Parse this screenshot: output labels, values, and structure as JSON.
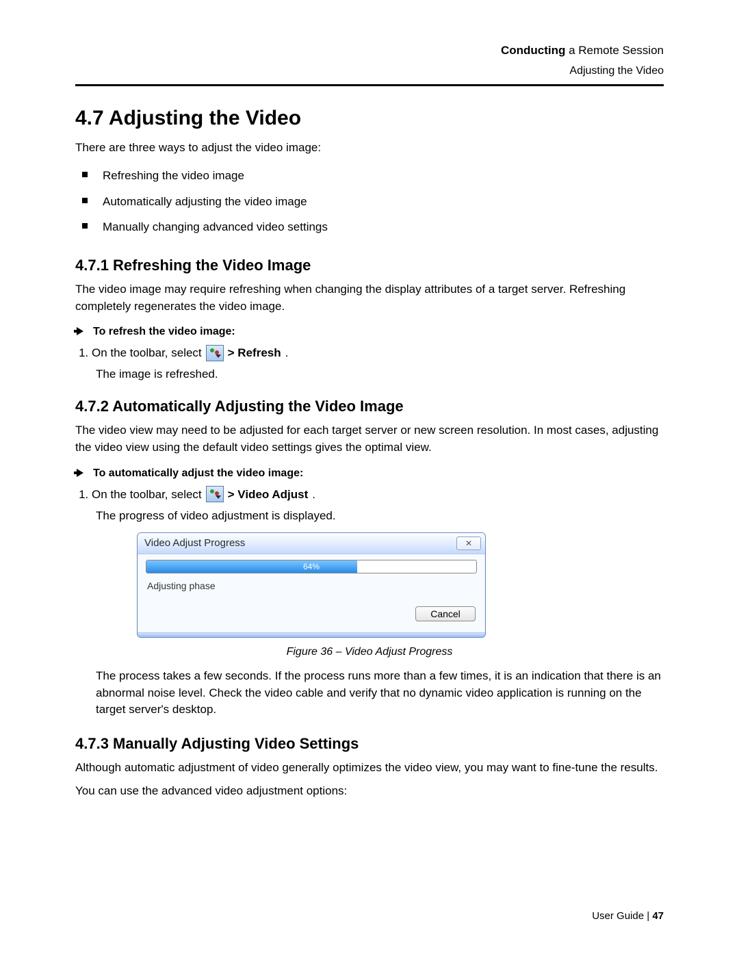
{
  "header": {
    "crumb_bold": "Conducting",
    "crumb_rest": " a Remote Session",
    "sub": "Adjusting the Video"
  },
  "s47": {
    "title": "4.7   Adjusting the Video",
    "intro": "There are three ways to adjust the video image:",
    "bullets": [
      "Refreshing the video image",
      "Automatically adjusting the video image",
      "Manually changing advanced video settings"
    ]
  },
  "s471": {
    "title": "4.7.1   Refreshing the Video Image",
    "para": "The video image may require refreshing when changing the display attributes of a target server. Refreshing completely regenerates the video image.",
    "instr_title": "To refresh the video image:",
    "step1_pre": "On the toolbar, select ",
    "step1_post": " > Refresh",
    "step1_dot": ".",
    "result": "The image is refreshed."
  },
  "s472": {
    "title": "4.7.2   Automatically Adjusting the Video Image",
    "para": "The video view may need to be adjusted for each target server or new screen resolution. In most cases, adjusting the video view using the default video settings gives the optimal view.",
    "instr_title": "To automatically adjust the video image:",
    "step1_pre": "On the toolbar, select ",
    "step1_post": " > Video Adjust",
    "step1_dot": ".",
    "result": "The progress of video adjustment is displayed.",
    "dialog": {
      "title": "Video Adjust Progress",
      "close": "✕",
      "percent": 64,
      "percent_label": "64%",
      "status": "Adjusting phase",
      "cancel": "Cancel"
    },
    "caption": "Figure 36 – Video Adjust Progress",
    "followup": "The process takes a few seconds. If the process runs more than a few times, it is an indication that there is an abnormal noise level. Check the video cable and verify that no dynamic video application is running on the target server's desktop."
  },
  "s473": {
    "title": "4.7.3   Manually Adjusting Video Settings",
    "para1": "Although automatic adjustment of video generally optimizes the video view, you may want to fine-tune the results.",
    "para2": "You can use the advanced video adjustment options:"
  },
  "footer": {
    "label": "User Guide | ",
    "page": "47"
  }
}
